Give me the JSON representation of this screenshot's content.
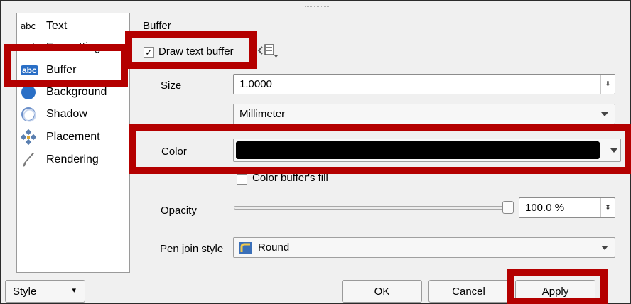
{
  "sidebar": {
    "items": [
      {
        "label": "Text",
        "icon": "abc"
      },
      {
        "label": "Formatting",
        "icon": "+ab"
      },
      {
        "label": "Buffer",
        "icon": "abc"
      },
      {
        "label": "Background",
        "icon": "background-circle-icon"
      },
      {
        "label": "Shadow",
        "icon": "shadow-icon"
      },
      {
        "label": "Placement",
        "icon": "placement-icon"
      },
      {
        "label": "Rendering",
        "icon": "rendering-brush-icon"
      }
    ],
    "selected_index": 2
  },
  "buffer": {
    "group_title": "Buffer",
    "draw_text_buffer": {
      "label": "Draw text buffer",
      "checked": true
    },
    "size": {
      "label": "Size",
      "value": "1.0000"
    },
    "unit": {
      "value": "Millimeter"
    },
    "color": {
      "label": "Color",
      "value": "#000000"
    },
    "color_buffer_fill": {
      "label": "Color buffer's fill",
      "checked": false
    },
    "opacity": {
      "label": "Opacity",
      "value": "100.0 %",
      "level": 1.0
    },
    "pen_join_style": {
      "label": "Pen join style",
      "value": "Round"
    }
  },
  "footer": {
    "style_label": "Style",
    "ok_label": "OK",
    "cancel_label": "Cancel",
    "apply_label": "Apply"
  },
  "colors": {
    "highlight_red": "#b40000",
    "selection_blue": "#2a6fc6",
    "buffer_color": "#000000"
  },
  "glyphs": {
    "abc_text": "abc",
    "abc_formatting": "+ab",
    "check": "✓",
    "spin": "⬍",
    "style_arrow": "▾"
  }
}
